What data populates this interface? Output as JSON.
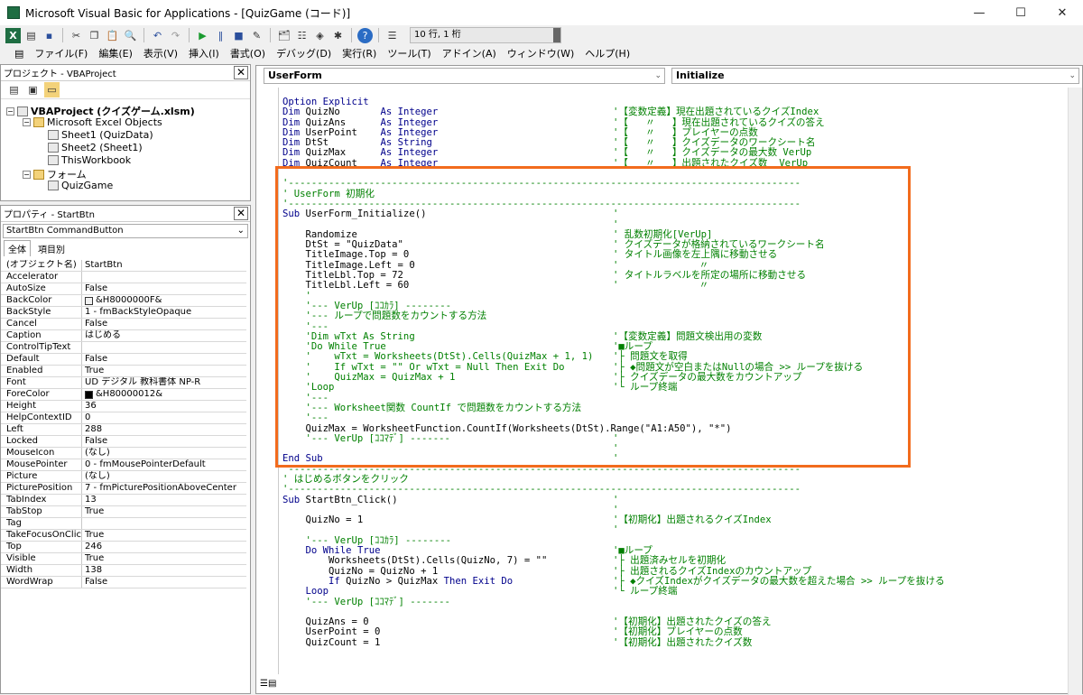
{
  "window": {
    "title": "Microsoft Visual Basic for Applications - [QuizGame (コード)]",
    "minimize": "—",
    "maximize": "☐",
    "close": "✕"
  },
  "toolbar": {
    "position": "10 行, 1 桁"
  },
  "menu": [
    "ファイル(F)",
    "編集(E)",
    "表示(V)",
    "挿入(I)",
    "書式(O)",
    "デバッグ(D)",
    "実行(R)",
    "ツール(T)",
    "アドイン(A)",
    "ウィンドウ(W)",
    "ヘルプ(H)"
  ],
  "project": {
    "title": "プロジェクト - VBAProject",
    "root": "VBAProject (クイズゲーム.xlsm)",
    "folder1": "Microsoft Excel Objects",
    "sheet1": "Sheet1 (QuizData)",
    "sheet2": "Sheet2 (Sheet1)",
    "wb": "ThisWorkbook",
    "folder2": "フォーム",
    "form": "QuizGame"
  },
  "properties": {
    "title": "プロパティ - StartBtn",
    "object": "StartBtn CommandButton",
    "tab_all": "全体",
    "tab_cat": "項目別",
    "rows": [
      [
        "(オブジェクト名)",
        "StartBtn"
      ],
      [
        "Accelerator",
        ""
      ],
      [
        "AutoSize",
        "False"
      ],
      [
        "BackColor",
        "&H8000000F&"
      ],
      [
        "BackStyle",
        "1 - fmBackStyleOpaque"
      ],
      [
        "Cancel",
        "False"
      ],
      [
        "Caption",
        "はじめる"
      ],
      [
        "ControlTipText",
        ""
      ],
      [
        "Default",
        "False"
      ],
      [
        "Enabled",
        "True"
      ],
      [
        "Font",
        "UD デジタル 教科書体 NP-R"
      ],
      [
        "ForeColor",
        "&H80000012&"
      ],
      [
        "Height",
        "36"
      ],
      [
        "HelpContextID",
        "0"
      ],
      [
        "Left",
        "288"
      ],
      [
        "Locked",
        "False"
      ],
      [
        "MouseIcon",
        "(なし)"
      ],
      [
        "MousePointer",
        "0 - fmMousePointerDefault"
      ],
      [
        "Picture",
        "(なし)"
      ],
      [
        "PicturePosition",
        "7 - fmPicturePositionAboveCenter"
      ],
      [
        "TabIndex",
        "13"
      ],
      [
        "TabStop",
        "True"
      ],
      [
        "Tag",
        ""
      ],
      [
        "TakeFocusOnClick",
        "True"
      ],
      [
        "Top",
        "246"
      ],
      [
        "Visible",
        "True"
      ],
      [
        "Width",
        "138"
      ],
      [
        "WordWrap",
        "False"
      ]
    ],
    "backcolor_swatch": "#f0f0f0",
    "forecolor_swatch": "#000000"
  },
  "code": {
    "object_combo": "UserForm",
    "proc_combo": "Initialize",
    "lines": [
      {
        "t": "Option Explicit",
        "c": ""
      },
      {
        "t": "Dim QuizNo       As Integer",
        "c": "'【変数定義】現在出題されているクイズIndex"
      },
      {
        "t": "Dim QuizAns      As Integer",
        "c": "'【   〃   】現在出題されているクイズの答え"
      },
      {
        "t": "Dim UserPoint    As Integer",
        "c": "'【   〃   】プレイヤーの点数"
      },
      {
        "t": "Dim DtSt         As String",
        "c": "'【   〃   】クイズデータのワークシート名"
      },
      {
        "t": "Dim QuizMax      As Integer",
        "c": "'【   〃   】クイズデータの最大数 VerUp"
      },
      {
        "t": "Dim QuizCount    As Integer",
        "c": "'【   〃   】出題されたクイズ数  VerUp"
      },
      {
        "t": "",
        "c": ""
      },
      {
        "t": "'-----------------------------------------------------------------------------------------",
        "c": ""
      },
      {
        "t": "' UserForm 初期化",
        "c": ""
      },
      {
        "t": "'-----------------------------------------------------------------------------------------",
        "c": ""
      },
      {
        "t": "Sub UserForm_Initialize()",
        "c": "'"
      },
      {
        "t": "",
        "c": "'"
      },
      {
        "t": "    Randomize",
        "c": "' 乱数初期化[VerUp]"
      },
      {
        "t": "    DtSt = \"QuizData\"",
        "c": "' クイズデータが格納されているワークシート名"
      },
      {
        "t": "    TitleImage.Top = 0",
        "c": "' タイトル画像を左上隅に移動させる"
      },
      {
        "t": "    TitleImage.Left = 0",
        "c": "'              〃"
      },
      {
        "t": "    TitleLbl.Top = 72",
        "c": "' タイトルラベルを所定の場所に移動させる"
      },
      {
        "t": "    TitleLbl.Left = 60",
        "c": "'              〃"
      },
      {
        "t": "    '",
        "c": ""
      },
      {
        "t": "    '--- VerUp [ｺｺｶﾗ] --------",
        "c": ""
      },
      {
        "t": "    '--- ループで問題数をカウントする方法",
        "c": ""
      },
      {
        "t": "    '---",
        "c": ""
      },
      {
        "t": "    'Dim wTxt As String",
        "c": "'【変数定義】問題文検出用の変数"
      },
      {
        "t": "    'Do While True",
        "c": "'■ループ"
      },
      {
        "t": "    '    wTxt = Worksheets(DtSt).Cells(QuizMax + 1, 1)",
        "c": "'├ 問題文を取得"
      },
      {
        "t": "    '    If wTxt = \"\" Or wTxt = Null Then Exit Do",
        "c": "'├ ◆問題文が空白またはNullの場合 >> ループを抜ける"
      },
      {
        "t": "    '    QuizMax = QuizMax + 1",
        "c": "'├ クイズデータの最大数をカウントアップ"
      },
      {
        "t": "    'Loop",
        "c": "'└ ループ終端"
      },
      {
        "t": "    '---",
        "c": ""
      },
      {
        "t": "    '--- Worksheet関数 CountIf で問題数をカウントする方法",
        "c": ""
      },
      {
        "t": "    '---",
        "c": ""
      },
      {
        "t": "    QuizMax = WorksheetFunction.CountIf(Worksheets(DtSt).Range(\"A1:A50\"), \"*\")",
        "c": ""
      },
      {
        "t": "    '--- VerUp [ｺｺﾏﾃﾞ] -------",
        "c": "'"
      },
      {
        "t": "",
        "c": "'"
      },
      {
        "t": "End Sub",
        "c": "'"
      },
      {
        "t": "'-----------------------------------------------------------------------------------------",
        "c": ""
      },
      {
        "t": "' はじめるボタンをクリック",
        "c": ""
      },
      {
        "t": "'-----------------------------------------------------------------------------------------",
        "c": ""
      },
      {
        "t": "Sub StartBtn_Click()",
        "c": "'"
      },
      {
        "t": "",
        "c": "'"
      },
      {
        "t": "    QuizNo = 1",
        "c": "'【初期化】出題されるクイズIndex"
      },
      {
        "t": "",
        "c": "'"
      },
      {
        "t": "    '--- VerUp [ｺｺｶﾗ] --------",
        "c": ""
      },
      {
        "t": "    Do While True",
        "c": "'■ループ"
      },
      {
        "t": "        Worksheets(DtSt).Cells(QuizNo, 7) = \"\"",
        "c": "'├ 出題済みセルを初期化"
      },
      {
        "t": "        QuizNo = QuizNo + 1",
        "c": "'├ 出題されるクイズIndexのカウントアップ"
      },
      {
        "t": "        If QuizNo > QuizMax Then Exit Do",
        "c": "'├ ◆クイズIndexがクイズデータの最大数を超えた場合 >> ループを抜ける"
      },
      {
        "t": "    Loop",
        "c": "'└ ループ終端"
      },
      {
        "t": "    '--- VerUp [ｺｺﾏﾃﾞ] -------",
        "c": ""
      },
      {
        "t": "",
        "c": ""
      },
      {
        "t": "    QuizAns = 0",
        "c": "'【初期化】出題されたクイズの答え"
      },
      {
        "t": "    UserPoint = 0",
        "c": "'【初期化】プレイヤーの点数"
      },
      {
        "t": "    QuizCount = 1",
        "c": "'【初期化】出題されたクイズ数"
      }
    ]
  }
}
